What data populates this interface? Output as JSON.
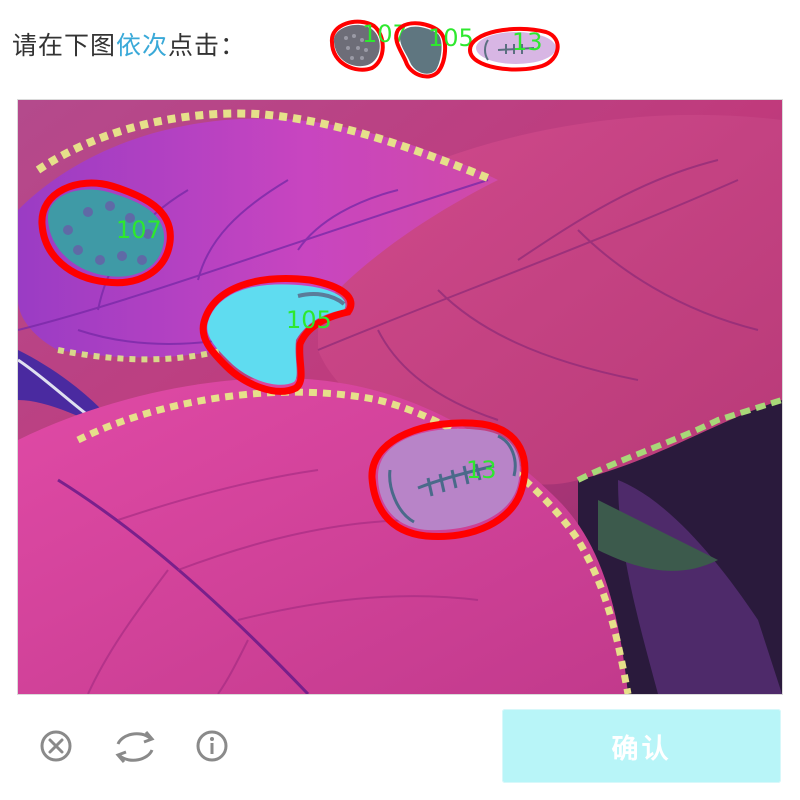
{
  "header": {
    "prompt_prefix": "请在下图",
    "prompt_highlight": "依次",
    "prompt_suffix": "点击：",
    "target_labels": [
      "107",
      "105",
      "13"
    ]
  },
  "canvas": {
    "markers": [
      {
        "label": "107",
        "name": "target-107-marker"
      },
      {
        "label": "105",
        "name": "target-105-marker"
      },
      {
        "label": "13",
        "name": "target-13-marker"
      }
    ]
  },
  "footer": {
    "close_icon": "close-circle-icon",
    "refresh_icon": "refresh-icon",
    "info_icon": "info-icon",
    "confirm_label": "确认"
  },
  "colors": {
    "highlight": "#3aa9d8",
    "marker_outline": "#ff0000",
    "marker_label": "#2ee82e",
    "confirm_bg": "#b8f5f8"
  }
}
